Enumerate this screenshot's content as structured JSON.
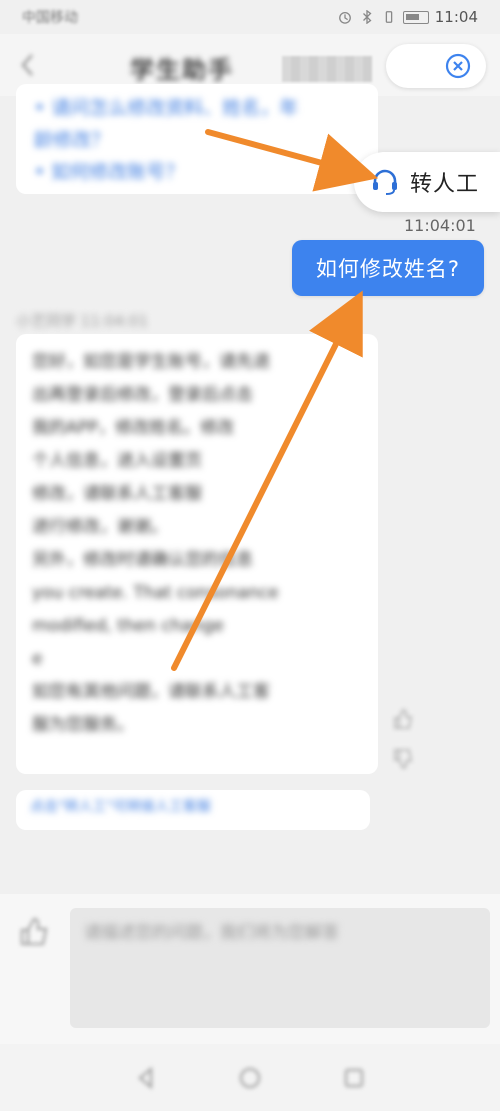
{
  "status_bar": {
    "carrier": "中国移动",
    "time": "11:04",
    "battery": "29"
  },
  "header": {
    "title": "学生助手",
    "close_icon": "close-circle-icon"
  },
  "faq_card": {
    "links": [
      "• 请问怎么修改资料、姓名，年",
      "龄修改？",
      "• 如何修改账号？"
    ]
  },
  "transfer": {
    "label": "转人工",
    "icon": "headset-icon"
  },
  "message": {
    "time": "11:04:01",
    "text": "如何修改姓名?"
  },
  "bot": {
    "label": "小艺同学 11:04:01",
    "paragraphs": [
      "您好，如您是学生账号，请先退",
      "出再登录后修改，登录后点击",
      "我的APP，修改姓名。修改",
      "个人信息，进入设置页",
      "修改，请联系人工客服",
      "进行修改，谢谢。",
      "另外，修改时请确认您的信息",
      "you create. That consonance",
      "modified, then change",
      "e",
      "如您有其他问题，请联系人工客",
      "服为您服务。"
    ]
  },
  "hint": {
    "text": "点击\"转人工\"可转接人工客服"
  },
  "input": {
    "placeholder": "请描述您的问题，我们将为您解答"
  },
  "colors": {
    "accent": "#3d83ee",
    "arrow": "#f08a2c"
  }
}
